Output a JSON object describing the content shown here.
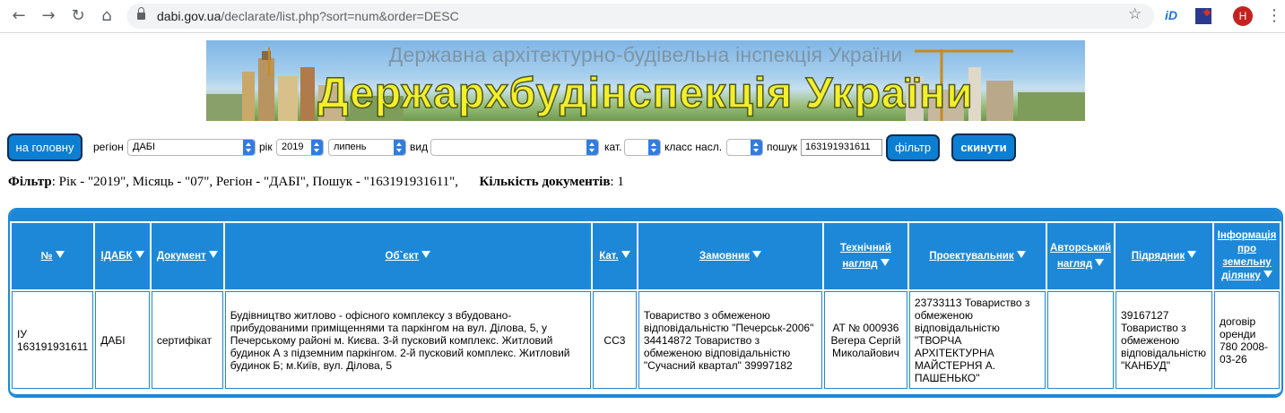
{
  "browser": {
    "url_host": "dabi.gov.ua",
    "url_path": "/declarate/list.php?sort=num&order=DESC",
    "profile_initial": "H",
    "ext1_label": "iD"
  },
  "banner": {
    "subtitle": "Державна архітектурно-будівельна інспекція України",
    "title": "Держархбудінспекція України"
  },
  "filters": {
    "home_button": "на головну",
    "region_label": "регіон",
    "region_value": "ДАБІ",
    "year_label": "рік",
    "year_value": "2019",
    "month_value": "липень",
    "type_label": "вид",
    "type_value": "",
    "cat_label": "кат.",
    "cat_value": "",
    "class_label": "класс насл.",
    "class_value": "",
    "search_label": "пошук",
    "search_value": "163191931611",
    "filter_button": "фільтр",
    "reset_button": "скинути"
  },
  "summary": {
    "filter_label": "Фільтр",
    "filter_text": ": Рік - \"2019\", Місяць - \"07\", Регіон - \"ДАБІ\", Пошук - \"163191931611\",",
    "count_label": "Кількість документів",
    "count_text": ": 1"
  },
  "table": {
    "headers": [
      "№",
      "ІДАБК",
      "Документ",
      "Об`єкт",
      "Кат.",
      "Замовник",
      "Технічний нагляд",
      "Проектувальник",
      "Авторський нагляд",
      "Підрядник",
      "Інформація про земельну ділянку"
    ],
    "rows": [
      [
        "ІУ 163191931611",
        "ДАБІ",
        "сертифікат",
        "Будівництво житлово - офісного комплексу з вбудовано-прибудованими приміщеннями та паркінгом на вул. Ділова, 5, у Печерському районі м. Києва. 3-й пусковий комплекс. Житловий будинок А з підземним паркінгом. 2-й пусковий комплекс. Житловий будинок Б; м.Київ, вул. Ділова, 5",
        "СС3",
        "Товариство з обмеженою відповідальністю \"Печерськ-2006\" 34414872 Товариство з обмеженою відповідальністю \"Сучасний квартал\" 39997182",
        "АТ № 000936 Вегера Сергій Миколайович",
        "23733113 Товариство з обмеженою відповідальністю \"ТВОРЧА АРХІТЕКТУРНА МАЙСТЕРНЯ А. ПАШЕНЬКО\"",
        "",
        "39167127 Товариство з обмеженою відповідальністю \"КАНБУД\"",
        "договір оренди 780 2008-03-26"
      ]
    ]
  }
}
